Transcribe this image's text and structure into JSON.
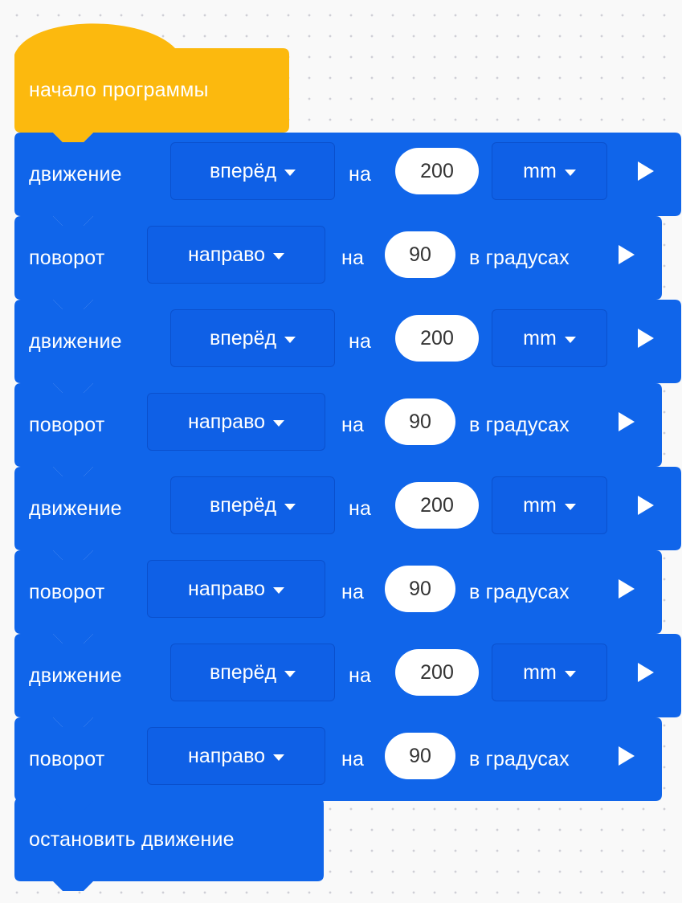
{
  "colors": {
    "event_block": "#fcb90e",
    "motion_block": "#1065ea",
    "workspace_background": "#f9f9f9"
  },
  "program": {
    "start_block": {
      "label": "начало программы"
    },
    "blocks": [
      {
        "type": "drive",
        "label": "движение",
        "direction": "вперёд",
        "on_label": "на",
        "value": "200",
        "unit": "mm"
      },
      {
        "type": "turn",
        "label": "поворот",
        "direction": "направо",
        "on_label": "на",
        "value": "90",
        "unit": "в градусах"
      },
      {
        "type": "drive",
        "label": "движение",
        "direction": "вперёд",
        "on_label": "на",
        "value": "200",
        "unit": "mm"
      },
      {
        "type": "turn",
        "label": "поворот",
        "direction": "направо",
        "on_label": "на",
        "value": "90",
        "unit": "в градусах"
      },
      {
        "type": "drive",
        "label": "движение",
        "direction": "вперёд",
        "on_label": "на",
        "value": "200",
        "unit": "mm"
      },
      {
        "type": "turn",
        "label": "поворот",
        "direction": "направо",
        "on_label": "на",
        "value": "90",
        "unit": "в градусах"
      },
      {
        "type": "drive",
        "label": "движение",
        "direction": "вперёд",
        "on_label": "на",
        "value": "200",
        "unit": "mm"
      },
      {
        "type": "turn",
        "label": "поворот",
        "direction": "направо",
        "on_label": "на",
        "value": "90",
        "unit": "в градусах"
      }
    ],
    "stop_block": {
      "label": "остановить движение"
    }
  }
}
